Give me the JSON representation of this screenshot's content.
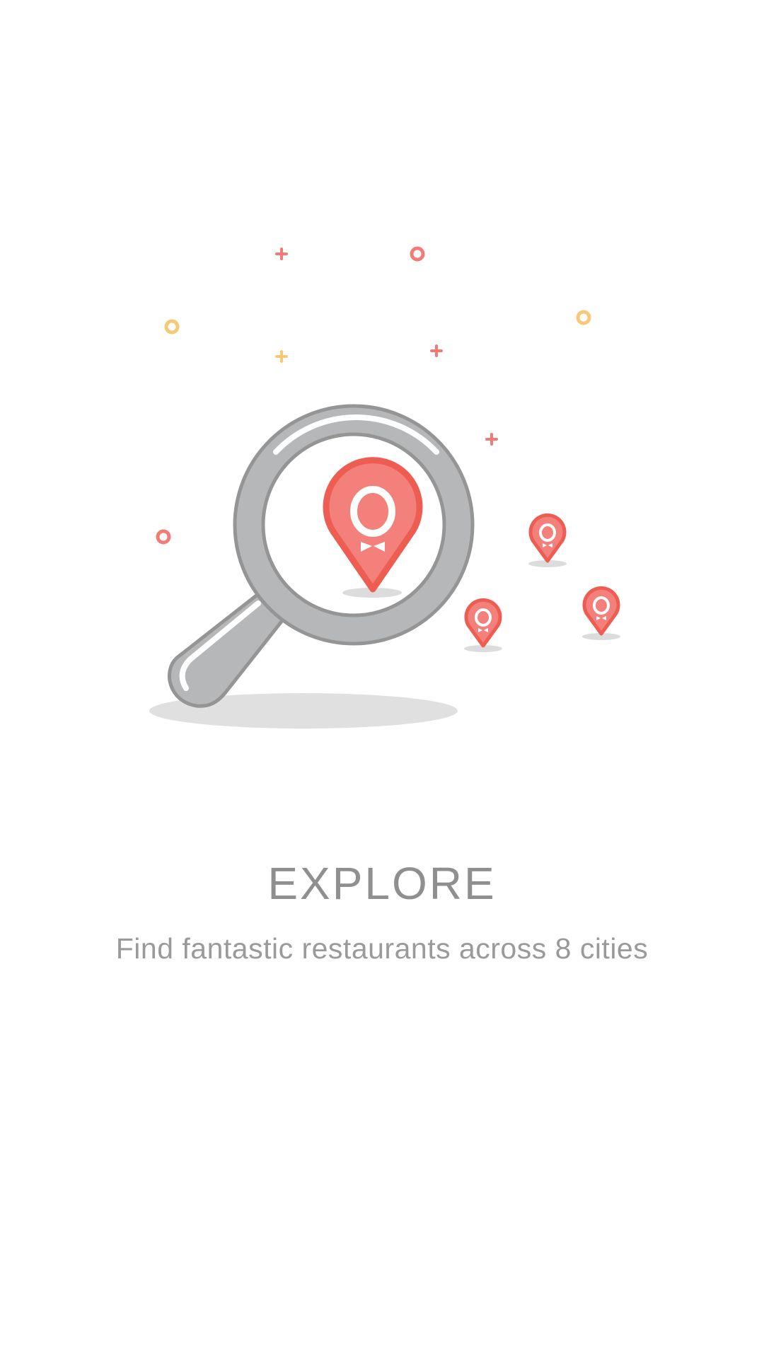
{
  "onboarding": {
    "title": "EXPLORE",
    "subtitle": "Find fantastic restaurants across 8 cities"
  },
  "illustration": {
    "icons": [
      "magnifier-icon",
      "map-pin-icon",
      "sparkle-icon"
    ],
    "colors": {
      "pin_fill": "#f3807a",
      "pin_stroke": "#ee5d52",
      "magnifier": "#b6b7b9",
      "magnifier_stroke": "#959595",
      "shadow": "#e0e0e0",
      "sparkle_red": "#ef7c76",
      "sparkle_yellow": "#f6c878"
    }
  }
}
